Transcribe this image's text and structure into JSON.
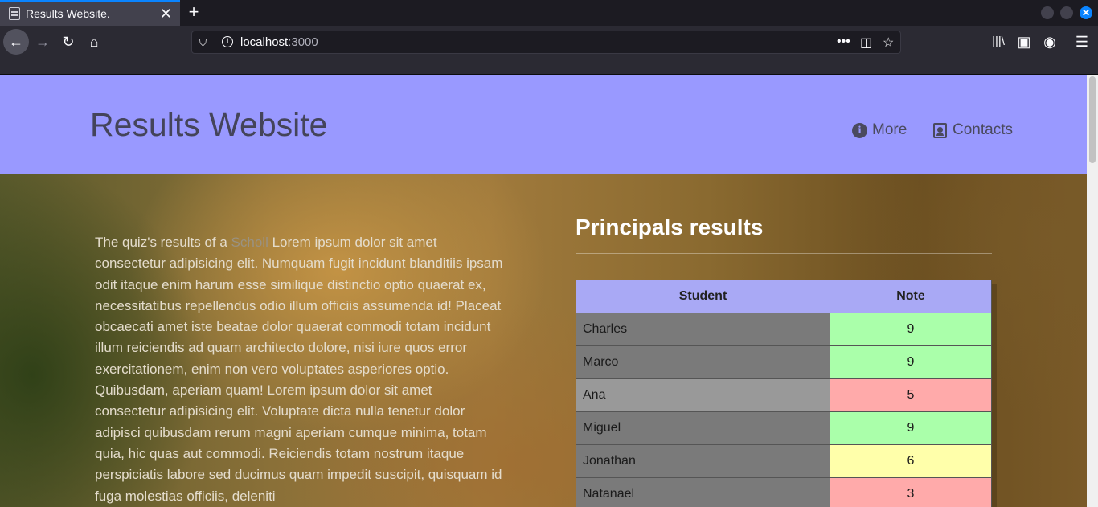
{
  "browser": {
    "tab_title": "Results Website.",
    "new_tab_label": "+",
    "url_host": "localhost",
    "url_port": ":3000"
  },
  "header": {
    "site_title": "Results Website",
    "nav": [
      {
        "label": "More",
        "icon": "info-circle-icon"
      },
      {
        "label": "Contacts",
        "icon": "address-card-icon"
      }
    ]
  },
  "intro": {
    "prefix": "The quiz's results of a ",
    "highlight": "Scholl",
    "body": " Lorem ipsum dolor sit amet consectetur adipisicing elit. Numquam fugit incidunt blanditiis ipsam odit itaque enim harum esse similique distinctio optio quaerat ex, necessitatibus repellendus odio illum officiis assumenda id! Placeat obcaecati amet iste beatae dolor quaerat commodi totam incidunt illum reiciendis ad quam architecto dolore, nisi iure quos error exercitationem, enim non vero voluptates asperiores optio. Quibusdam, aperiam quam! Lorem ipsum dolor sit amet consectetur adipisicing elit. Voluptate dicta nulla tenetur dolor adipisci quibusdam rerum magni aperiam cumque minima, totam quia, hic quas aut commodi. Reiciendis totam nostrum itaque perspiciatis labore sed ducimus quam impedit suscipit, quisquam id fuga molestias officiis, deleniti"
  },
  "results": {
    "title": "Principals results",
    "columns": [
      "Student",
      "Note"
    ],
    "rows": [
      {
        "student": "Charles",
        "note": "9",
        "color": "#aaffaa",
        "highlight": false
      },
      {
        "student": "Marco",
        "note": "9",
        "color": "#aaffaa",
        "highlight": false
      },
      {
        "student": "Ana",
        "note": "5",
        "color": "#ffaaaa",
        "highlight": true
      },
      {
        "student": "Miguel",
        "note": "9",
        "color": "#aaffaa",
        "highlight": false
      },
      {
        "student": "Jonathan",
        "note": "6",
        "color": "#ffffaa",
        "highlight": false
      },
      {
        "student": "Natanael",
        "note": "3",
        "color": "#ffaaaa",
        "highlight": false
      }
    ]
  }
}
